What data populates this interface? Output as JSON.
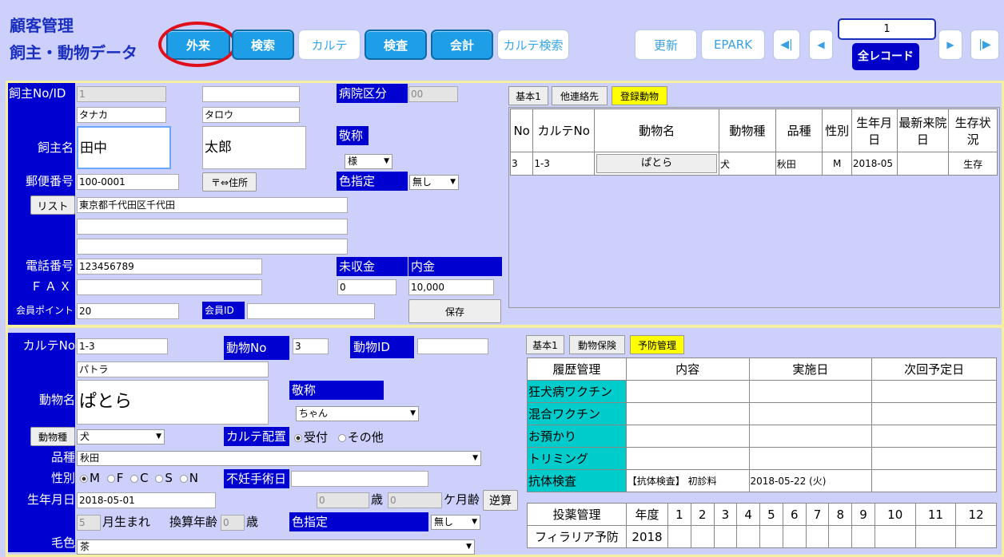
{
  "header": {
    "title1": "顧客管理",
    "title2": "飼主・動物データ"
  },
  "toolbar": {
    "gairai": "外来",
    "kensaku": "検索",
    "karute": "カルテ",
    "kensa": "検査",
    "kaikei": "会計",
    "karute_kensaku": "カルテ検索",
    "koushin": "更新",
    "epark": "EPARK",
    "page": "1",
    "all_records": "全レコード"
  },
  "owner": {
    "no_label": "飼主No/ID",
    "no": "1",
    "kana_last": "タナカ",
    "kana_first": "タロウ",
    "name_label": "飼主名",
    "last": "田中",
    "first": "太郎",
    "hospital_label": "病院区分",
    "hospital": "00",
    "keisho_label": "敬称",
    "keisho": "様",
    "zip_label": "郵便番号",
    "zip": "100-0001",
    "zip_btn": "〒⇔住所",
    "color_label": "色指定",
    "color": "無し",
    "list_btn": "リスト",
    "address": "東京都千代田区千代田",
    "tel_label": "電話番号",
    "tel": "123456789",
    "fax_label": "ＦＡＸ",
    "unpaid_label": "未収金",
    "unpaid": "0",
    "deposit_label": "内金",
    "deposit": "10,000",
    "point_label": "会員ポイント",
    "point": "20",
    "member_id_label": "会員ID",
    "save": "保存"
  },
  "owner_tabs": [
    "基本1",
    "他連絡先",
    "登録動物"
  ],
  "animals_table": {
    "headers": [
      "No",
      "カルテNo",
      "動物名",
      "動物種",
      "品種",
      "性別",
      "生年月日",
      "最新来院日",
      "生存状況"
    ],
    "rows": [
      [
        "3",
        "1-3",
        "ぱとら",
        "犬",
        "秋田",
        "M",
        "2018-05",
        "",
        "生存"
      ]
    ]
  },
  "animal": {
    "karute_label": "カルテNo",
    "karute": "1-3",
    "animal_no_label": "動物No",
    "animal_no": "3",
    "animal_id_label": "動物ID",
    "kana": "パトラ",
    "name_label": "動物名",
    "name": "ぱとら",
    "keisho_label": "敬称",
    "keisho": "ちゃん",
    "species_btn": "動物種",
    "species": "犬",
    "placement_label": "カルテ配置",
    "placement_opt1": "受付",
    "placement_opt2": "その他",
    "breed_label": "品種",
    "breed": "秋田",
    "sex_label": "性別",
    "sex_opts": [
      "M",
      "F",
      "C",
      "S",
      "N"
    ],
    "sterile_label": "不妊手術日",
    "birth_label": "生年月日",
    "birth": "2018-05-01",
    "age_years": "0",
    "age_unit": "歳",
    "age_months": "0",
    "age_month_unit": "ケ月齢",
    "calc_btn": "逆算",
    "birth_month": "5",
    "birth_month_unit": "月生まれ",
    "conv_label": "換算年齢",
    "conv_age": "0",
    "conv_unit": "歳",
    "color_label": "色指定",
    "color": "無し",
    "coat_label": "毛色",
    "coat": "茶"
  },
  "animal_tabs": [
    "基本1",
    "動物保険",
    "予防管理"
  ],
  "history_table": {
    "headers": [
      "履歴管理",
      "内容",
      "実施日",
      "次回予定日"
    ],
    "rows": [
      [
        "狂犬病ワクチン",
        "",
        "",
        ""
      ],
      [
        "混合ワクチン",
        "",
        "",
        ""
      ],
      [
        "お預かり",
        "",
        "",
        ""
      ],
      [
        "トリミング",
        "",
        "",
        ""
      ],
      [
        "抗体検査",
        "【抗体検査】 初診料",
        "2018-05-22 (火)",
        ""
      ]
    ]
  },
  "med_table": {
    "headers": [
      "投薬管理",
      "年度",
      "1",
      "2",
      "3",
      "4",
      "5",
      "6",
      "7",
      "8",
      "9",
      "10",
      "11",
      "12"
    ],
    "rows": [
      [
        "フィラリア予防",
        "2018"
      ]
    ]
  }
}
